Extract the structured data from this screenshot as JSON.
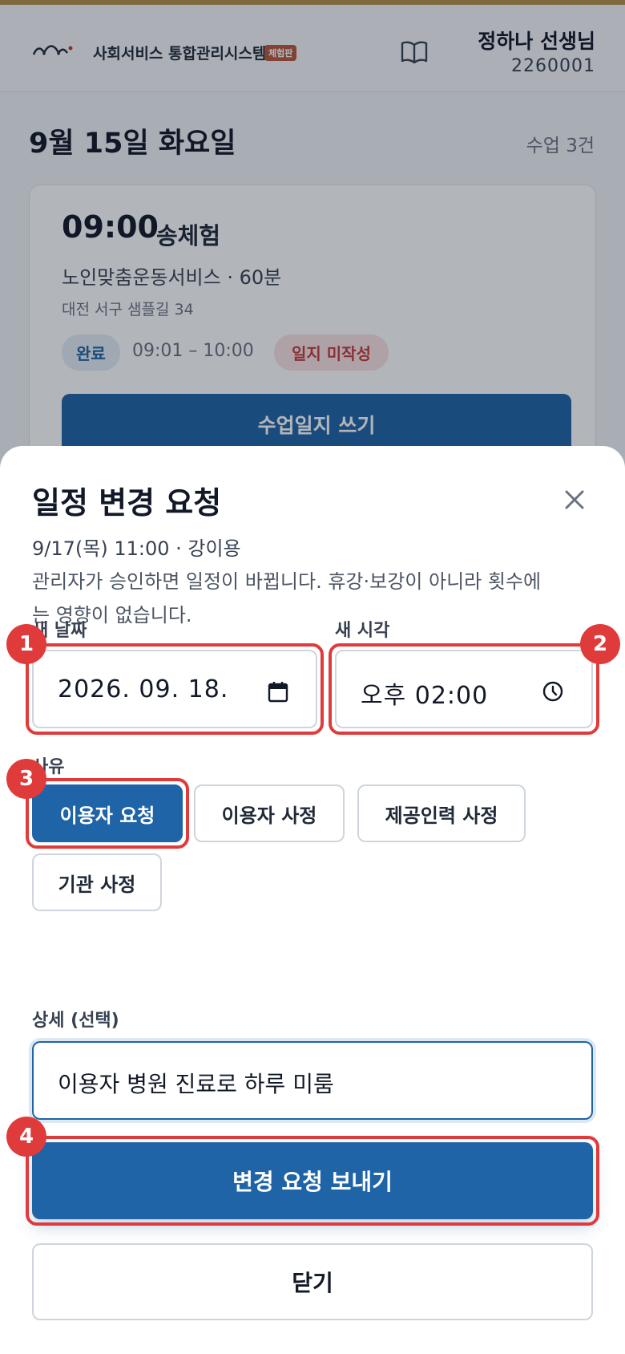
{
  "header": {
    "app_title": "사회서비스 통합관리시스템",
    "trial_badge": "체험판",
    "user_name": "정하나 선생님",
    "user_id": "2260001"
  },
  "day": {
    "title": "9월 15일 화요일",
    "class_count": "수업 3건"
  },
  "class_card": {
    "time": "09:00",
    "client": "송체험",
    "service": "노인맞춤운동서비스 · 60분",
    "address": "대전 서구 샘플길 34",
    "status": "완료",
    "range": "09:01 – 10:00",
    "log_status": "일지 미작성",
    "cta": "수업일지 쓰기"
  },
  "sheet": {
    "title": "일정 변경 요청",
    "subtitle": "9/17(목) 11:00 · 강이용",
    "description": "관리자가 승인하면 일정이 바뀝니다. 휴강·보강이 아니라 횟수에는 영향이 없습니다.",
    "new_date_label": "새 날짜",
    "new_date_value": "2026. 09. 18.",
    "new_time_label": "새 시각",
    "new_time_value": "오후 02:00",
    "reason_label": "사유",
    "reasons": [
      "이용자 요청",
      "이용자 사정",
      "제공인력 사정",
      "기관 사정"
    ],
    "selected_reason": "이용자 요청",
    "detail_label": "상세 (선택)",
    "detail_value": "이용자 병원 진료로 하루 미룸",
    "submit_label": "변경 요청 보내기",
    "close_label": "닫기"
  },
  "markers": [
    "1",
    "2",
    "3",
    "4"
  ],
  "colors": {
    "primary": "#1f64a6",
    "highlight": "#e03b3b",
    "accent_bar": "#b48f4a"
  },
  "icons": [
    "logo-mark",
    "book-icon",
    "close-icon",
    "calendar-icon",
    "clock-icon"
  ]
}
